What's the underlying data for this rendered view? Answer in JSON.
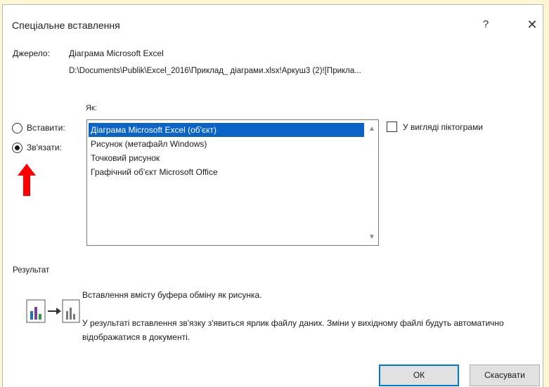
{
  "dialog": {
    "title": "Спеціальне вставлення",
    "help": "?",
    "close": "✕"
  },
  "source": {
    "label": "Джерело:",
    "name": "Діаграма Microsoft Excel",
    "path": "D:\\Documents\\Publik\\Excel_2016\\Приклад_ діаграми.xlsx!Аркуш3 (2)![Прикла..."
  },
  "as_label": "Як:",
  "options": {
    "paste_label": "Вставити:",
    "link_label": "Зв'язати:",
    "selected": "link"
  },
  "formats": [
    {
      "label": "Діаграма Microsoft Excel (об'єкт)",
      "selected": true
    },
    {
      "label": "Рисунок (метафайл Windows)",
      "selected": false
    },
    {
      "label": "Точковий рисунок",
      "selected": false
    },
    {
      "label": "Графічний об'єкт Microsoft Office",
      "selected": false
    }
  ],
  "display_as_icon": {
    "label": "У вигляді піктограми",
    "checked": false
  },
  "result": {
    "label": "Результат",
    "line1": "Вставлення вмісту буфера обміну як рисунка.",
    "line2": "У результаті вставлення зв'язку з'явиться ярлик файлу даних. Зміни у вихідному файлі будуть автоматично відображатися в документі."
  },
  "buttons": {
    "ok": "ОК",
    "cancel": "Скасувати"
  },
  "colors": {
    "selection": "#0a64c8",
    "annotation_arrow": "#ff0000",
    "background": "#fdf6d5"
  }
}
